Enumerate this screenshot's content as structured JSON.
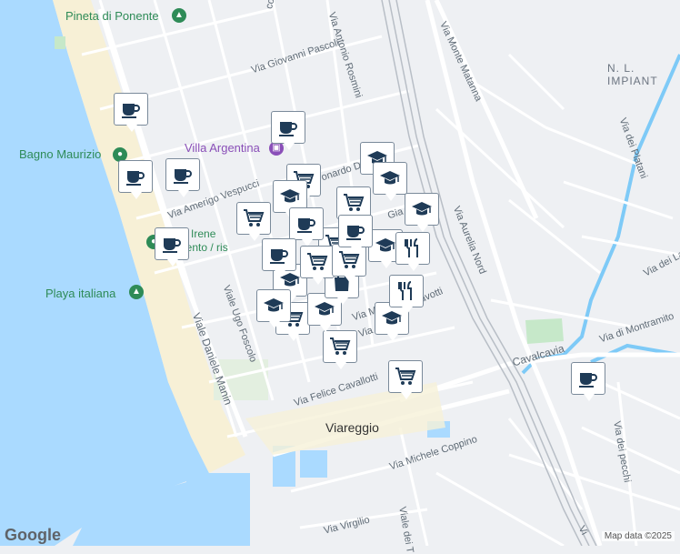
{
  "places": {
    "pineta": "Pineta di Ponente",
    "bagno": "Bagno Maurizio",
    "villa": "Villa Argentina",
    "bagno_irene_1": "agno Irene",
    "bagno_irene_2": "bilimento / ris",
    "playa": "Playa italiana",
    "city": "Viareggio",
    "zone": "N. L. IMPIANT"
  },
  "streets": {
    "pascoli": "Via Giovanni Pascoli",
    "rosmini": "Via Antonio Rosmini",
    "matanna": "Via Monte Matanna",
    "vespucci": "Via Amerigo Vespucci",
    "leonardo": "onardo Da",
    "aurelia": "Via Aurelia Nord",
    "platani": "Via dei Platani",
    "dellat": "Via dei Lat",
    "montramito": "Via di Montramito",
    "cavalcavia": "Cavalcavia",
    "foscolo": "Viale Ugo Foscolo",
    "manin": "Viale Daniele Manin",
    "cavallotti": "Via Felice Cavallotti",
    "coppino": "Via Michele Coppino",
    "virgilio": "Via Virgilio",
    "pecchi": "Via dei pecchi",
    "vialedei": "Viale dei T",
    "gia": "Gia",
    "viam": "Via M",
    "viag": "Via G",
    "avotti": "avotti",
    "ccelli": "ccelli",
    "vi": "Vi"
  },
  "markers": [
    {
      "type": "cafe",
      "icon": "coffee-cup-icon"
    },
    {
      "type": "cafe",
      "icon": "coffee-cup-icon"
    },
    {
      "type": "cafe",
      "icon": "coffee-cup-icon"
    },
    {
      "type": "cafe",
      "icon": "coffee-cup-icon"
    },
    {
      "type": "cafe",
      "icon": "coffee-cup-icon"
    },
    {
      "type": "cafe",
      "icon": "coffee-cup-icon"
    },
    {
      "type": "grocery",
      "icon": "shopping-cart-icon"
    },
    {
      "type": "grocery",
      "icon": "shopping-cart-icon"
    },
    {
      "type": "grocery",
      "icon": "shopping-cart-icon"
    },
    {
      "type": "grocery",
      "icon": "shopping-cart-icon"
    },
    {
      "type": "grocery",
      "icon": "shopping-cart-icon"
    },
    {
      "type": "grocery",
      "icon": "shopping-cart-icon"
    },
    {
      "type": "grocery",
      "icon": "shopping-cart-icon"
    },
    {
      "type": "school",
      "icon": "graduation-cap-icon"
    },
    {
      "type": "school",
      "icon": "graduation-cap-icon"
    },
    {
      "type": "school",
      "icon": "graduation-cap-icon"
    },
    {
      "type": "school",
      "icon": "graduation-cap-icon"
    },
    {
      "type": "school",
      "icon": "graduation-cap-icon"
    },
    {
      "type": "school",
      "icon": "graduation-cap-icon"
    },
    {
      "type": "school",
      "icon": "graduation-cap-icon"
    },
    {
      "type": "school",
      "icon": "graduation-cap-icon"
    },
    {
      "type": "school",
      "icon": "graduation-cap-icon"
    },
    {
      "type": "restaurant",
      "icon": "fork-knife-icon"
    },
    {
      "type": "restaurant",
      "icon": "fork-knife-icon"
    },
    {
      "type": "shopping",
      "icon": "shopping-bag-icon"
    },
    {
      "type": "cafe",
      "icon": "coffee-cup-icon"
    },
    {
      "type": "cafe",
      "icon": "coffee-cup-icon"
    },
    {
      "type": "grocery",
      "icon": "shopping-cart-icon"
    },
    {
      "type": "grocery",
      "icon": "shopping-cart-icon"
    },
    {
      "type": "cafe",
      "icon": "coffee-cup-icon"
    }
  ],
  "footer": {
    "logo": "Google",
    "attribution": "Map data ©2025"
  },
  "colors": {
    "sea": "#aadaff",
    "beach": "#f7f0d6",
    "land": "#eef0f3",
    "road": "#ffffff",
    "major_road": "#ffeba1",
    "park": "#c6e8c9",
    "river": "#7ecaf7",
    "pin_icon": "#1f3b57"
  }
}
